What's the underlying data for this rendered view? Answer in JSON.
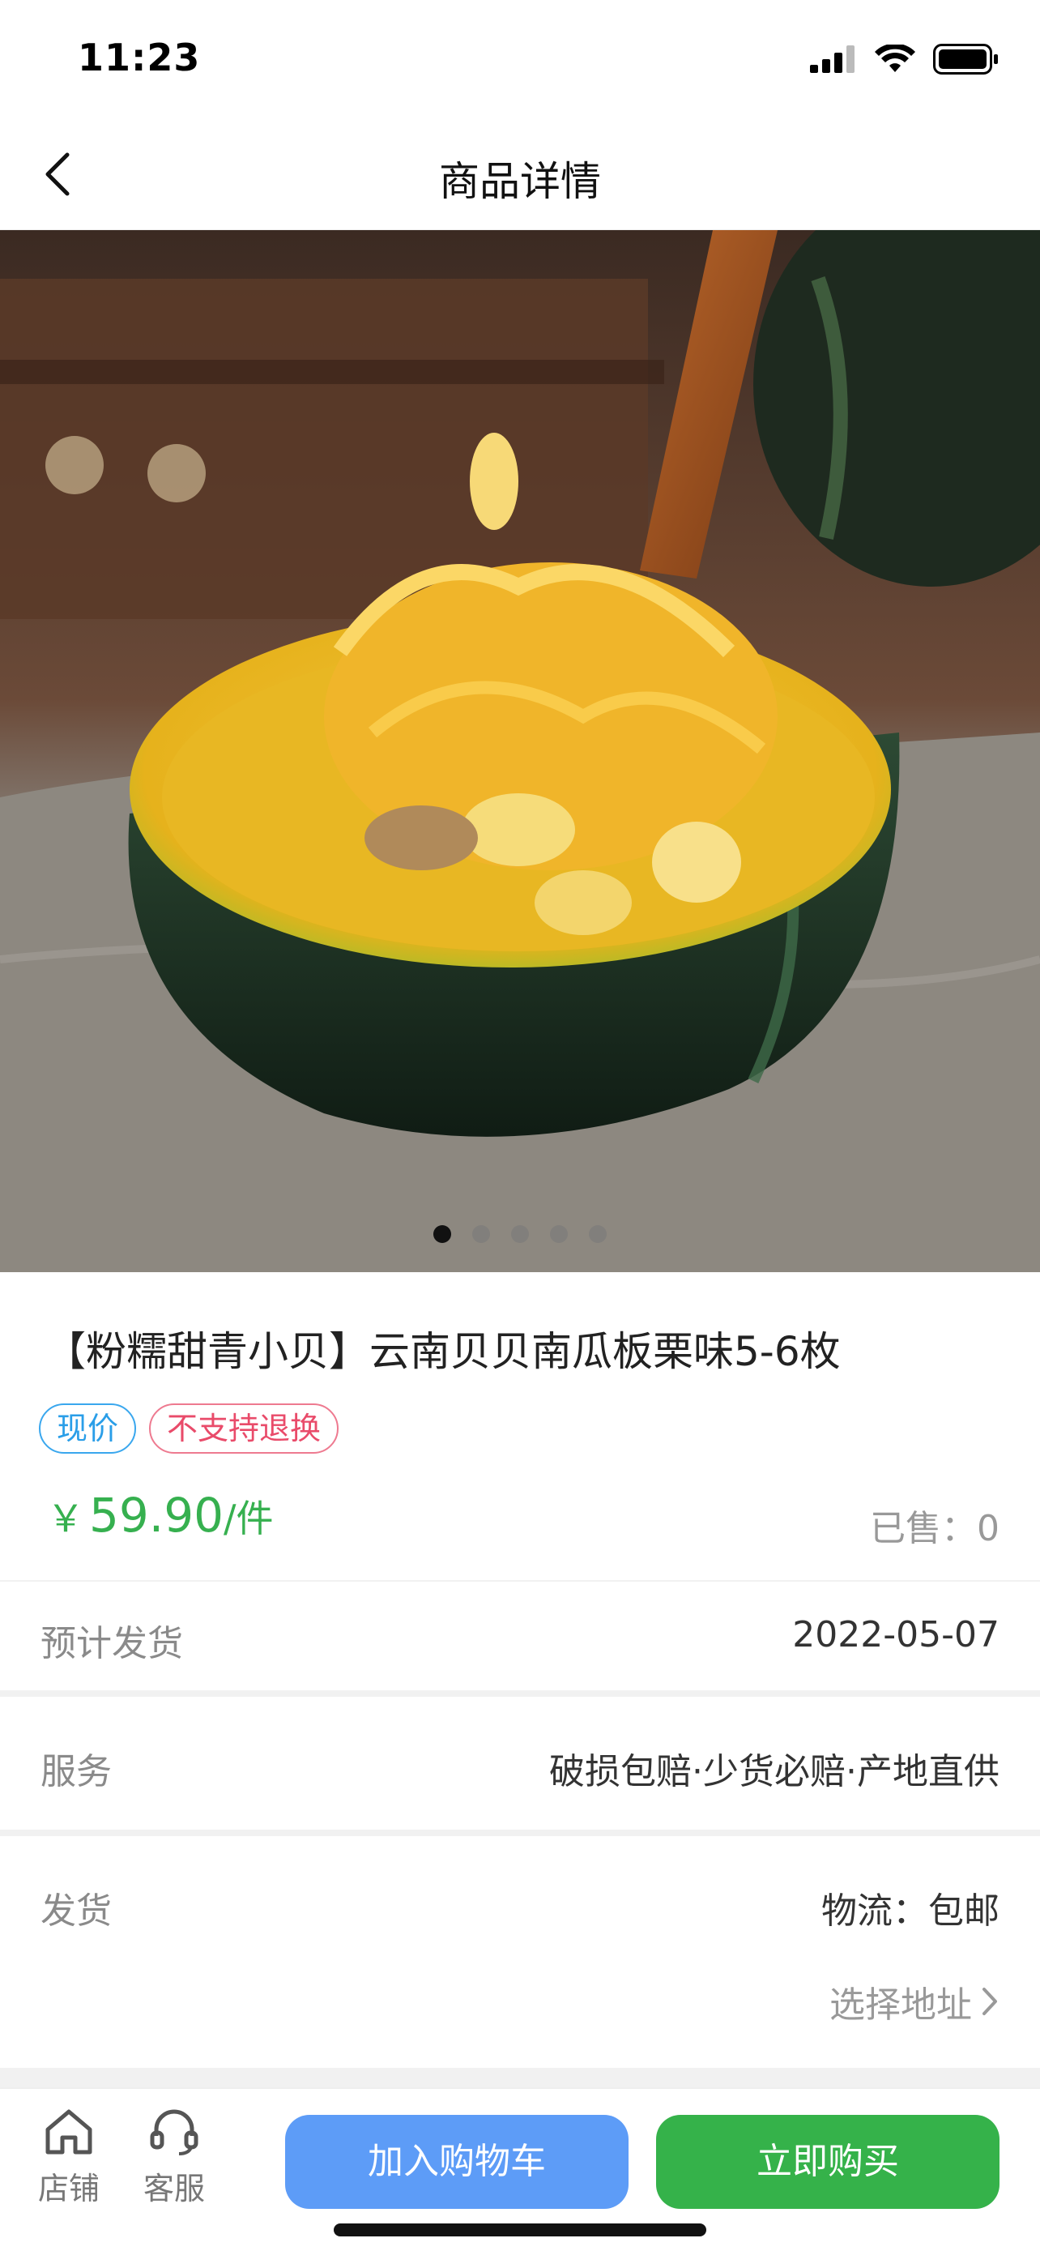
{
  "status_bar": {
    "time": "11:23"
  },
  "nav": {
    "title": "商品详情"
  },
  "carousel": {
    "total": 5,
    "active_index": 0
  },
  "product": {
    "title": "【粉糯甜青小贝】云南贝贝南瓜板栗味5-6枚",
    "tags": [
      "现价",
      "不支持退换"
    ],
    "price_symbol": "￥",
    "price": "59.90",
    "price_unit": "/件",
    "sold_label": "已售：",
    "sold_count": "0"
  },
  "shipping_date": {
    "label": "预计发货",
    "value": "2022-05-07"
  },
  "service": {
    "label": "服务",
    "value": "破损包赔·少货必赔·产地直供"
  },
  "delivery": {
    "label": "发货",
    "value": "物流：包邮",
    "select_address": "选择地址"
  },
  "bottom_bar": {
    "shop_label": "店铺",
    "service_label": "客服",
    "add_to_cart": "加入购物车",
    "buy_now": "立即购买"
  },
  "colors": {
    "price_green": "#36b04f",
    "cart_blue": "#5d9cf7",
    "buy_green": "#35b24a",
    "tag_blue": "#2a9ee8",
    "tag_red": "#e94b6a"
  },
  "icons": [
    "signal-icon",
    "wifi-icon",
    "battery-icon",
    "back-arrow-icon",
    "chevron-right-icon",
    "shop-home-icon",
    "headset-icon"
  ]
}
